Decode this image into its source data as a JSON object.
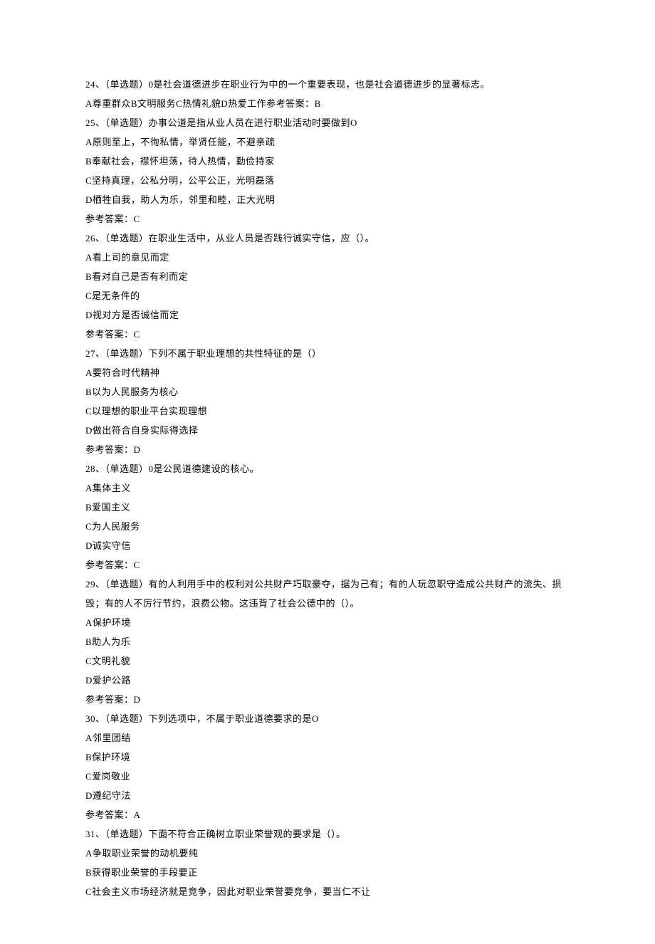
{
  "lines": [
    "24、（单选题）0是社会道德进步在职业行为中的一个重要表现，也是社会道德进步的显著标志。",
    "A尊重群众B文明服务C热情礼貌D热爱工作参考答案：B",
    "25、（单选题）办事公道是指从业人员在进行职业活动时要做到O",
    "A原则至上，不徇私情，举贤任能，不避亲疏",
    "B奉献社会，襟怀坦荡，待人热情，勤俭持家",
    "C坚持真理，公私分明，公平公正，光明磊落",
    "D栖牲自我，助人为乐，邻里和睦，正大光明",
    "参考答案：C",
    "26、（单选题）在职业生活中，从业人员是否践行诚实守信，应（）。",
    "A看上司的意见而定",
    "B看对自己是否有利而定",
    "C是无条件的",
    "D视对方是否诚信而定",
    "参考答案：C",
    "27、（单选题）下列不属于职业理想的共性特征的是（）",
    "A要符合时代精神",
    "B以为人民服务为核心",
    "C以理想的职业平台实现理想",
    "D做出符合自身实际得选择",
    "参考答案：D",
    "28、（单选题）0是公民道德建设的核心。",
    "A集体主义",
    "B爱国主义",
    "C为人民服务",
    "D诚实守信",
    "参考答案：C",
    "29、（单选题）有的人利用手中的权利对公共财产巧取豪夺，据为己有；有的人玩忽职守造成公共财产的流失、损毁；有的人不厉行节约，浪费公物。这违背了社会公德中的（）。",
    "A保护环境",
    "B助人为乐",
    "C文明礼貌",
    "D爱护公路",
    "参考答案：D",
    "30、（单选题）下列选项中，不属于职业道德要求的是O",
    "A邻里团结",
    "B保护环境",
    "C爱岗敬业",
    "D遵纪守法",
    "参考答案：A",
    "31、（单选题）下面不符合正确树立职业荣誉观的要求是（）。",
    "A争取职业荣誉的动机要纯",
    "B获得职业荣誉的手段要正",
    "C社会主义市场经济就是竞争，因此对职业荣誉要竞争，要当仁不让"
  ]
}
